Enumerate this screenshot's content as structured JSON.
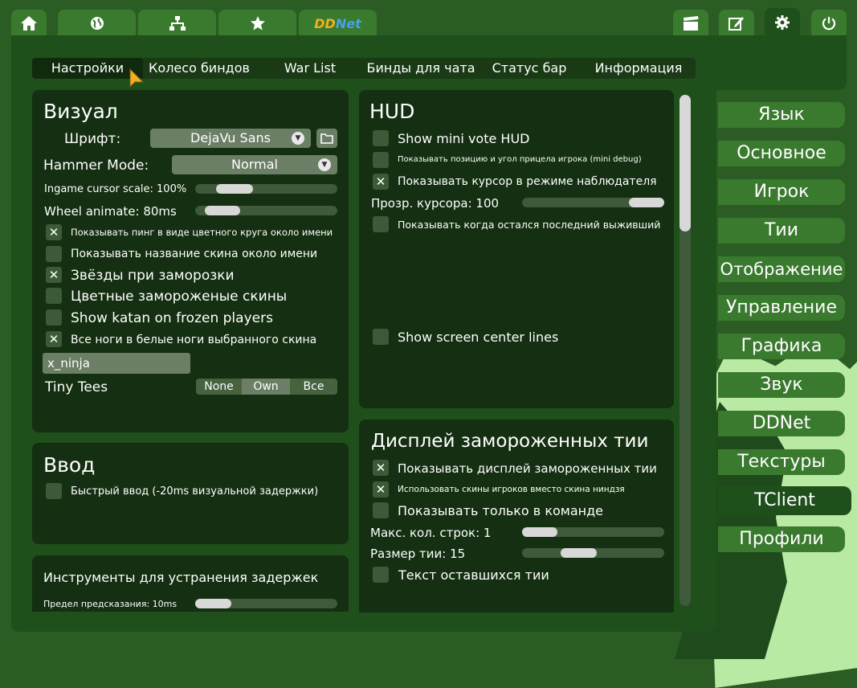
{
  "topbar": {
    "ddnet_label_a": "DD",
    "ddnet_label_b": "Net"
  },
  "subtabs": [
    "Настройки",
    "Колесо биндов",
    "War List",
    "Бинды для чата",
    "Статус бар",
    "Информация"
  ],
  "visual": {
    "title": "Визуал",
    "font_label": "Шрифт:",
    "font_value": "DejaVu Sans",
    "hammer_label": "Hammer Mode:",
    "hammer_value": "Normal",
    "cursor_scale": "Ingame cursor scale: 100%",
    "wheel_animate": "Wheel animate: 80ms",
    "opt_ping": "Показывать пинг в виде цветного круга около имени",
    "opt_skin_name": "Показывать название скина около имени",
    "opt_stars": "Звёзды при заморозки",
    "opt_colored_frozen": "Цветные замороженые скины",
    "opt_katan": "Show katan on frozen players",
    "opt_white_feet": "Все ноги в белые ноги выбранного скина",
    "skin_input": "x_ninja",
    "tiny_tees_label": "Tiny Tees",
    "tiny_tees_options": [
      "None",
      "Own",
      "Все"
    ]
  },
  "input": {
    "title": "Ввод",
    "fast_input": "Быстрый ввод (-20ms визуальной задержки)"
  },
  "lag": {
    "title": "Инструменты для устранения задержек",
    "prediction_limit": "Предел предсказания: 10ms"
  },
  "hud": {
    "title": "HUD",
    "mini_vote": "Show mini vote HUD",
    "mini_debug": "Показывать позицию и угол прицела игрока (mini debug)",
    "spectator_cursor": "Показывать курсор в режиме наблюдателя",
    "cursor_opacity": "Прозр. курсора: 100",
    "last_survivor": "Показывать когда остался последний выживший",
    "center_lines": "Show screen center lines"
  },
  "frozen": {
    "title": "Дисплей замороженных тии",
    "show_display": "Показывать дисплей замороженных тии",
    "use_player_skins": "Использовать скины игроков вместо скина ниндзя",
    "team_only": "Показывать только в команде",
    "max_rows": "Макс. кол. строк: 1",
    "tee_size": "Размер тии: 15",
    "remaining_text": "Текст оставшихся тии"
  },
  "sidebar": [
    "Язык",
    "Основное",
    "Игрок",
    "Тии",
    "Отображение",
    "Управление",
    "Графика",
    "Звук",
    "DDNet",
    "Текстуры",
    "TClient",
    "Профили"
  ],
  "settings": {
    "cursor_scale_pct": 100,
    "wheel_animate_ms": 80,
    "cursor_opacity": 100,
    "max_rows": 1,
    "tee_size": 15,
    "prediction_ms": 10
  },
  "colors": {
    "bg": "#2a5c24",
    "panel": "#1f4f1a",
    "box": "#142f11",
    "tab": "#3a7a2e",
    "accent_cursor": "#f0b020"
  }
}
